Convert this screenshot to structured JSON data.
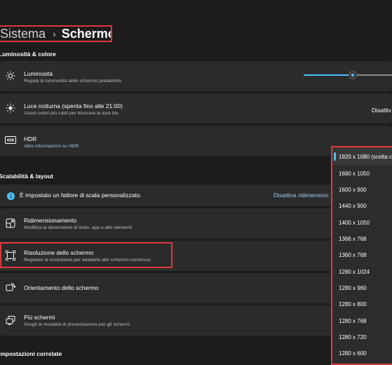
{
  "breadcrumb": {
    "parent": "Sistema",
    "separator": "›",
    "current": "Schermo"
  },
  "sections": {
    "brightness_color": "Luminosità & colore",
    "scale_layout": "Scalabilità & layout",
    "related": "Impostazioni correlate"
  },
  "brightness": {
    "title": "Luminosità",
    "subtitle": "Regola la luminosità dello schermo predefinito",
    "level_percent": 55
  },
  "night_light": {
    "title": "Luce notturna (spenta fino alle 21:00)",
    "subtitle": "Usare colori più caldi per bloccare la luce blu",
    "value": "Disattiv"
  },
  "hdr": {
    "title": "HDR",
    "link": "Altre informazioni su HDR",
    "icon_text": "HDR"
  },
  "scale_notice": {
    "text": "È impostato un fattore di scala personalizzato.",
    "action": "Disattiva ridimension"
  },
  "scaling": {
    "title": "Ridimensionamento",
    "subtitle": "Modifica la dimensione di testo, app e altri elementi"
  },
  "resolution": {
    "title": "Risoluzione dello schermo",
    "subtitle": "Regolare la risoluzione per adattarla allo schermo connesso"
  },
  "orientation": {
    "title": "Orientamento dello schermo"
  },
  "multi_display": {
    "title": "Più schermi",
    "subtitle": "Scegli la modalità di presentazione per gli schermi"
  },
  "resolution_options": [
    "1920 x 1080 (scelta c",
    "1680 x 1050",
    "1600 x 900",
    "1440 x 900",
    "1400 x 1050",
    "1366 x 768",
    "1360 x 768",
    "1280 x 1024",
    "1280 x 960",
    "1280 x 800",
    "1280 x 768",
    "1280 x 720",
    "1280 x 600"
  ],
  "colors": {
    "accent": "#4cc2ff",
    "highlight": "#e0383e",
    "card": "#2b2b2b",
    "background": "#1c1c1c"
  }
}
